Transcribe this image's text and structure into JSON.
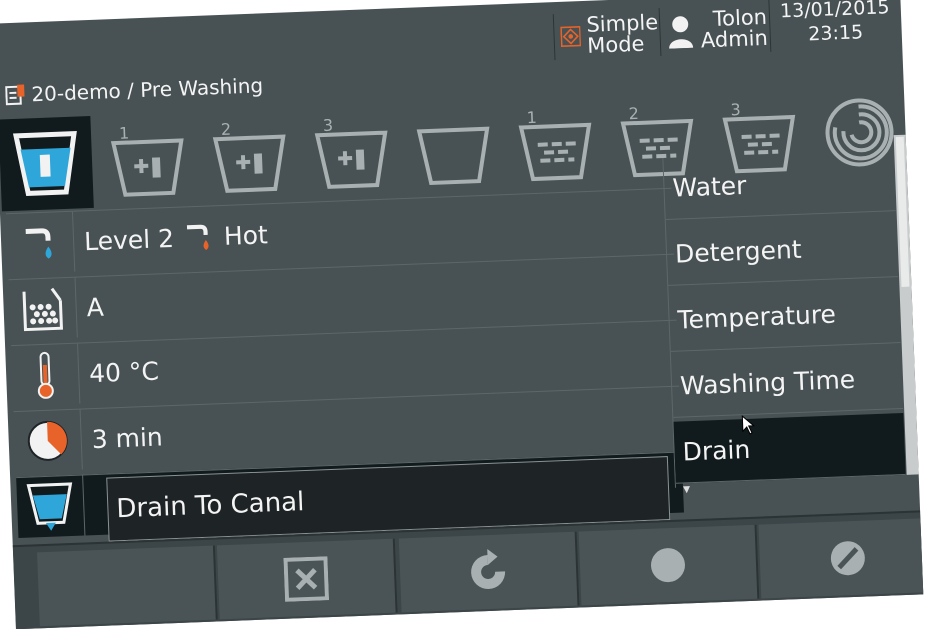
{
  "header": {
    "breadcrumb": "20-demo / Pre Washing",
    "mode_line1": "Simple",
    "mode_line2": "Mode",
    "user_line1": "Tolon",
    "user_line2": "Admin",
    "date": "13/01/2015",
    "time": "23:15"
  },
  "tabs": [
    {
      "name": "water-tab",
      "icon": "water-tub-icon",
      "active": true
    },
    {
      "name": "detergent-1-tab",
      "badge": "1",
      "icon": "tub-add-icon"
    },
    {
      "name": "detergent-2-tab",
      "badge": "2",
      "icon": "tub-add-icon"
    },
    {
      "name": "detergent-3-tab",
      "badge": "3",
      "icon": "tub-add-icon"
    },
    {
      "name": "empty-tub-tab",
      "icon": "empty-tub-icon"
    },
    {
      "name": "rinse-1-tab",
      "badge": "1",
      "icon": "tub-rinse-icon"
    },
    {
      "name": "rinse-2-tab",
      "badge": "2",
      "icon": "tub-rinse-icon"
    },
    {
      "name": "rinse-3-tab",
      "badge": "3",
      "icon": "tub-rinse-icon"
    },
    {
      "name": "spin-tab",
      "icon": "spin-icon"
    }
  ],
  "rows": {
    "water_level": "Level  2",
    "water_temp": "Hot",
    "detergent": "A",
    "temperature": "40  °C",
    "washing_time": "3  min",
    "drain": "Drain  To  Canal"
  },
  "labels": {
    "water": "Water",
    "detergent": "Detergent",
    "temperature": "Temperature",
    "washing_time": "Washing  Time",
    "drain": "Drain"
  },
  "colors": {
    "background": "#485254",
    "accent_blue": "#2fa6d9",
    "accent_orange": "#e8632a",
    "selected": "#111a1d"
  }
}
